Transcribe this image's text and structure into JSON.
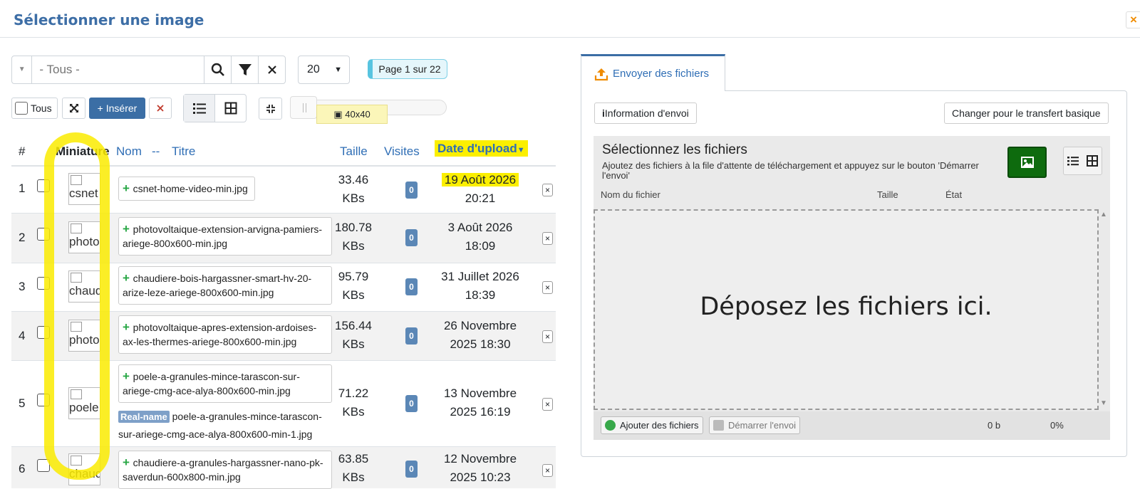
{
  "header": {
    "title": "Sélectionner une image",
    "close_label": "×"
  },
  "search": {
    "placeholder": "- Tous -",
    "per_page": "20",
    "page_info": "Page 1 sur 22"
  },
  "toolbar": {
    "all_label": "Tous",
    "insert_label": "+ Insérer",
    "thumb_size": "40x40"
  },
  "table": {
    "headers": {
      "num": "#",
      "thumb": "Miniature",
      "name": "Nom",
      "sep": "--",
      "title": "Titre",
      "size": "Taille",
      "visits": "Visites",
      "date": "Date d'upload"
    },
    "rows": [
      {
        "num": "1",
        "alt": "csnet",
        "name": "csnet-home-video-min.jpg",
        "size_val": "33.46",
        "size_unit": "KBs",
        "visits": "0",
        "date1": "19 Août 2026",
        "date2": "20:21"
      },
      {
        "num": "2",
        "alt": "photo",
        "name": "photovoltaique-extension-arvigna-pamiers-ariege-800x600-min.jpg",
        "size_val": "180.78",
        "size_unit": "KBs",
        "visits": "0",
        "date1": "3 Août 2026",
        "date2": "18:09"
      },
      {
        "num": "3",
        "alt": "chaud",
        "name": "chaudiere-bois-hargassner-smart-hv-20-arize-leze-ariege-800x600-min.jpg",
        "size_val": "95.79",
        "size_unit": "KBs",
        "visits": "0",
        "date1": "31 Juillet 2026",
        "date2": "18:39"
      },
      {
        "num": "4",
        "alt": "photo",
        "name": "photovoltaique-apres-extension-ardoises-ax-les-thermes-ariege-800x600-min.jpg",
        "size_val": "156.44",
        "size_unit": "KBs",
        "visits": "0",
        "date1": "26 Novembre",
        "date2": "2025 18:30"
      },
      {
        "num": "5",
        "alt": "poele",
        "name": "poele-a-granules-mince-tarascon-sur-ariege-cmg-ace-alya-800x600-min.jpg",
        "real_label": "Real-name",
        "real_name": "poele-a-granules-mince-tarascon-sur-ariege-cmg-ace-alya-800x600-min-1.jpg",
        "size_val": "71.22",
        "size_unit": "KBs",
        "visits": "0",
        "date1": "13 Novembre",
        "date2": "2025 16:19"
      },
      {
        "num": "6",
        "alt": "chaud",
        "name": "chaudiere-a-granules-hargassner-nano-pk-saverdun-600x800-min.jpg",
        "size_val": "63.85",
        "size_unit": "KBs",
        "visits": "0",
        "date1": "12 Novembre",
        "date2": "2025 10:23"
      }
    ]
  },
  "upload": {
    "tab_label": "Envoyer des fichiers",
    "info_label": "Information d'envoi",
    "info_prefix": "i",
    "switch_label": "Changer pour le transfert basique",
    "title": "Sélectionnez les fichiers",
    "description": "Ajoutez des fichiers à la file d'attente de téléchargement et appuyez sur le bouton 'Démarrer l'envoi'",
    "col_name": "Nom du fichier",
    "col_size": "Taille",
    "col_state": "État",
    "drop_text": "Déposez les fichiers ici.",
    "add_label": "Ajouter des fichiers",
    "start_label": "Démarrer l'envoi",
    "total_size": "0 b",
    "percent": "0%"
  },
  "colors": {
    "accent": "#3b6ea5",
    "highlight": "#fbef00",
    "title": "#3d6ea6"
  }
}
